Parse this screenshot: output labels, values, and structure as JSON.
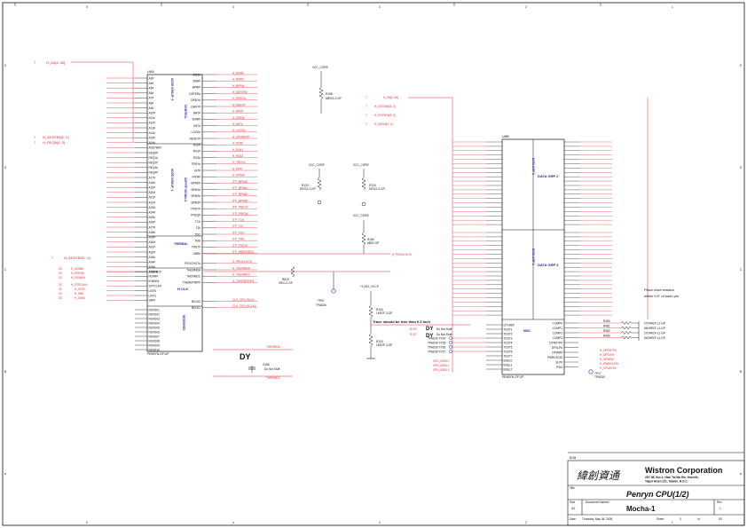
{
  "border": {
    "cols": [
      "1",
      "2",
      "3",
      "4",
      "5"
    ],
    "rows": [
      "A",
      "B",
      "C",
      "D",
      "E"
    ]
  },
  "u_left": {
    "ref": "U6A",
    "part": "PENRYN-GP-UP",
    "sections": [
      "ADDR GROUP_0",
      "CONTROL",
      "ADDR GROUP_1",
      "XDP/ITP SIGNALS",
      "THERMAL",
      "H CLK",
      "RESERVED"
    ],
    "sub_thermal": "THERMAL",
    "sub_hclk": "H CLK",
    "left_pins": [
      "A3#",
      "A4#",
      "A5#",
      "A6#",
      "A7#",
      "A8#",
      "A9#",
      "A10#",
      "A11#",
      "A12#",
      "A13#",
      "A14#",
      "A15#",
      "A16#",
      "ADSTB0#",
      "REQ0#",
      "REQ1#",
      "REQ2#",
      "REQ3#",
      "REQ4#",
      "A17#",
      "A18#",
      "A19#",
      "A20#",
      "A21#",
      "A22#",
      "A23#",
      "A24#",
      "A25#",
      "A26#",
      "A27#",
      "A28#",
      "A29#",
      "A30#",
      "A31#",
      "A32#",
      "A33#",
      "A34#",
      "A35#",
      "ADSTB1#",
      "A20M#",
      "FERR#",
      "IGNNE#",
      "STPCLK#",
      "LINT0",
      "LINT1",
      "SMI#"
    ],
    "right_pins": [
      "ADS#",
      "BNR#",
      "BPRI#",
      "DEFER#",
      "DRDY#",
      "DBSY#",
      "BR0#",
      "IERR#",
      "INIT#",
      "LOCK#",
      "RESET#",
      "RS0#",
      "RS1#",
      "RS2#",
      "TRDY#",
      "HIT#",
      "HITM#",
      "BPM0#",
      "BPM1#",
      "BPM2#",
      "BPM3#",
      "PRDY#",
      "PREQ#",
      "TCK",
      "TDI",
      "TDO",
      "TMS",
      "TRST#",
      "DBR#",
      "PROCHOT#",
      "THERMDA",
      "THERMDC",
      "THERMTRIP#",
      "BCLK0",
      "BCLK1"
    ],
    "reserved_pins": [
      "RSVD01",
      "RSVD02",
      "RSVD03",
      "RSVD04",
      "RSVD05",
      "RSVD06",
      "RSVD07",
      "RSVD08",
      "RSVD09",
      "RSVD10"
    ]
  },
  "u_right": {
    "ref": "U6B",
    "part": "PENRYN-GP-UP",
    "groups": [
      "DATA GRP 0",
      "DATA GRP 1",
      "DATA GRP 2",
      "DATA GRP 3",
      "MISC"
    ],
    "misc_pins": [
      "GTLREF",
      "TEST1",
      "TEST2",
      "TEST3",
      "TEST4",
      "TEST5",
      "TEST6",
      "TEST7",
      "BSEL0",
      "BSEL1",
      "BSEL2",
      "COMP0",
      "COMP1",
      "COMP2",
      "COMP3",
      "DPRSTP#",
      "DPSLP#",
      "DPWR#",
      "PWRGOOD",
      "SLP#",
      "PSI#"
    ]
  },
  "nets_left": {
    "addr": "H_A#[3..35]",
    "adstb": "H_ADSTB#[1..0]",
    "req": "H_REQ#[4..0]",
    "a20m": "H_A20M#",
    "ferr": "H_FERR#",
    "ignne": "H_IGNNE#",
    "stpclk": "H_STPCLK#",
    "intr": "H_INTR",
    "nmi": "H_NMI",
    "smi": "H_SMI#"
  },
  "nets_right_u6a": [
    "H_ADS#",
    "H_BNR#",
    "H_BPRI#",
    "H_DEFER#",
    "H_DRDY#",
    "H_DBSY#",
    "H_BR0#",
    "H_IERR#",
    "H_INIT#",
    "H_LOCK#",
    "H_CPURST#",
    "H_RS#0",
    "H_RS#1",
    "H_RS#2",
    "H_TRDY#",
    "H_HIT#",
    "H_HITM#",
    "ITP_BPM#0",
    "ITP_BPM#1",
    "ITP_BPM#2",
    "ITP_BPM#3",
    "ITP_PRDY#",
    "ITP_PREQ#",
    "ITP_TCK",
    "ITP_TDI",
    "ITP_TDO",
    "ITP_TMS",
    "ITP_TRST#",
    "ITP_DBRESET#",
    "H_PROCHOT#",
    "H_THERMDA",
    "H_THERMDC",
    "H_THERMTRIP#",
    "CLK_CPU_BCLK",
    "CLK_CPU_BCLK#"
  ],
  "nets_data": [
    "H_D#[0..63]",
    "H_DSTBN#[3..0]",
    "H_DSTBP#[3..0]",
    "H_DINV#[3..0]"
  ],
  "power": [
    "VCC_CORE",
    "VCC_CORE",
    "VCC_CORE",
    "VCC_CORE",
    "+1.05V_VCCP"
  ],
  "resistors": [
    {
      "ref": "R198",
      "val": "68R2J-2-GP"
    },
    {
      "ref": "R133",
      "val": "51R2J-2-GP"
    },
    {
      "ref": "R134",
      "val": "51R2J-2-GP"
    },
    {
      "ref": "R180",
      "val": "68R2-GP"
    },
    {
      "ref": "R819",
      "val": "0R2J-2-GP"
    },
    {
      "ref": "R104",
      "val": "1KR2F-3-GP"
    },
    {
      "ref": "R103",
      "val": "2KR2F-3-GP"
    },
    {
      "ref": "R102",
      "val": "Do Not Stuff"
    },
    {
      "ref": "R107",
      "val": "Do Not Stuff"
    },
    {
      "ref": "R480",
      "val": "27D4R2F-L1-GP"
    },
    {
      "ref": "R481",
      "val": "54D9R2F-L1-GP"
    },
    {
      "ref": "R482",
      "val": "27D4R2F-L1-GP"
    },
    {
      "ref": "R483",
      "val": "54D9R2F-L1-GP"
    }
  ],
  "testpoints": [
    "TP67",
    "TPAD30",
    "TPAD30",
    "TPAD30",
    "TPAD30",
    "TPAD30",
    "TP17"
  ],
  "tp_labels": [
    "TP24",
    "TP25",
    "TP26",
    "TP27"
  ],
  "cap": {
    "ref": "C456",
    "val": "Do Not Stuff"
  },
  "dy_marks": [
    "DY",
    "DY",
    "DY"
  ],
  "notes": {
    "trace": "Trace should be less than 0.5 inch",
    "resistor": "Place each resistor within 0.5\" of each pin"
  },
  "misc_nets": [
    "H_DPRSTP#",
    "H_DPSLP#",
    "H_DPWR#",
    "H_PWRGOOD",
    "H_CPUSLP#",
    "PSI#",
    "CPU_BSEL0",
    "CPU_BSEL1",
    "CPU_BSEL2",
    "THERMDA",
    "THERMDC"
  ],
  "title_block": {
    "logo_chinese": "緯創資通",
    "company": "Wistron Corporation",
    "address1": "21F, 88, Sec.1, Hsin Tai Wu Rd., Hsichih,",
    "address2": "Taipei Hsien 221, Taiwan, R.O.C.",
    "title_label": "Title",
    "title": "Penryn CPU(1/2)",
    "size_label": "Size",
    "size": "A3",
    "docnum_label": "Document Number",
    "docnum": "Mocha-1",
    "rev_label": "Rev",
    "rev": "-1",
    "date_label": "Date:",
    "date": "Thursday, May 08, 2008",
    "sheet_label": "Sheet",
    "sheet": "3",
    "of_label": "of",
    "of": "53",
    "bom": "BOM"
  },
  "colors": {
    "wire": "#e0303a",
    "part": "#111111",
    "text": "#1f2a9e"
  }
}
